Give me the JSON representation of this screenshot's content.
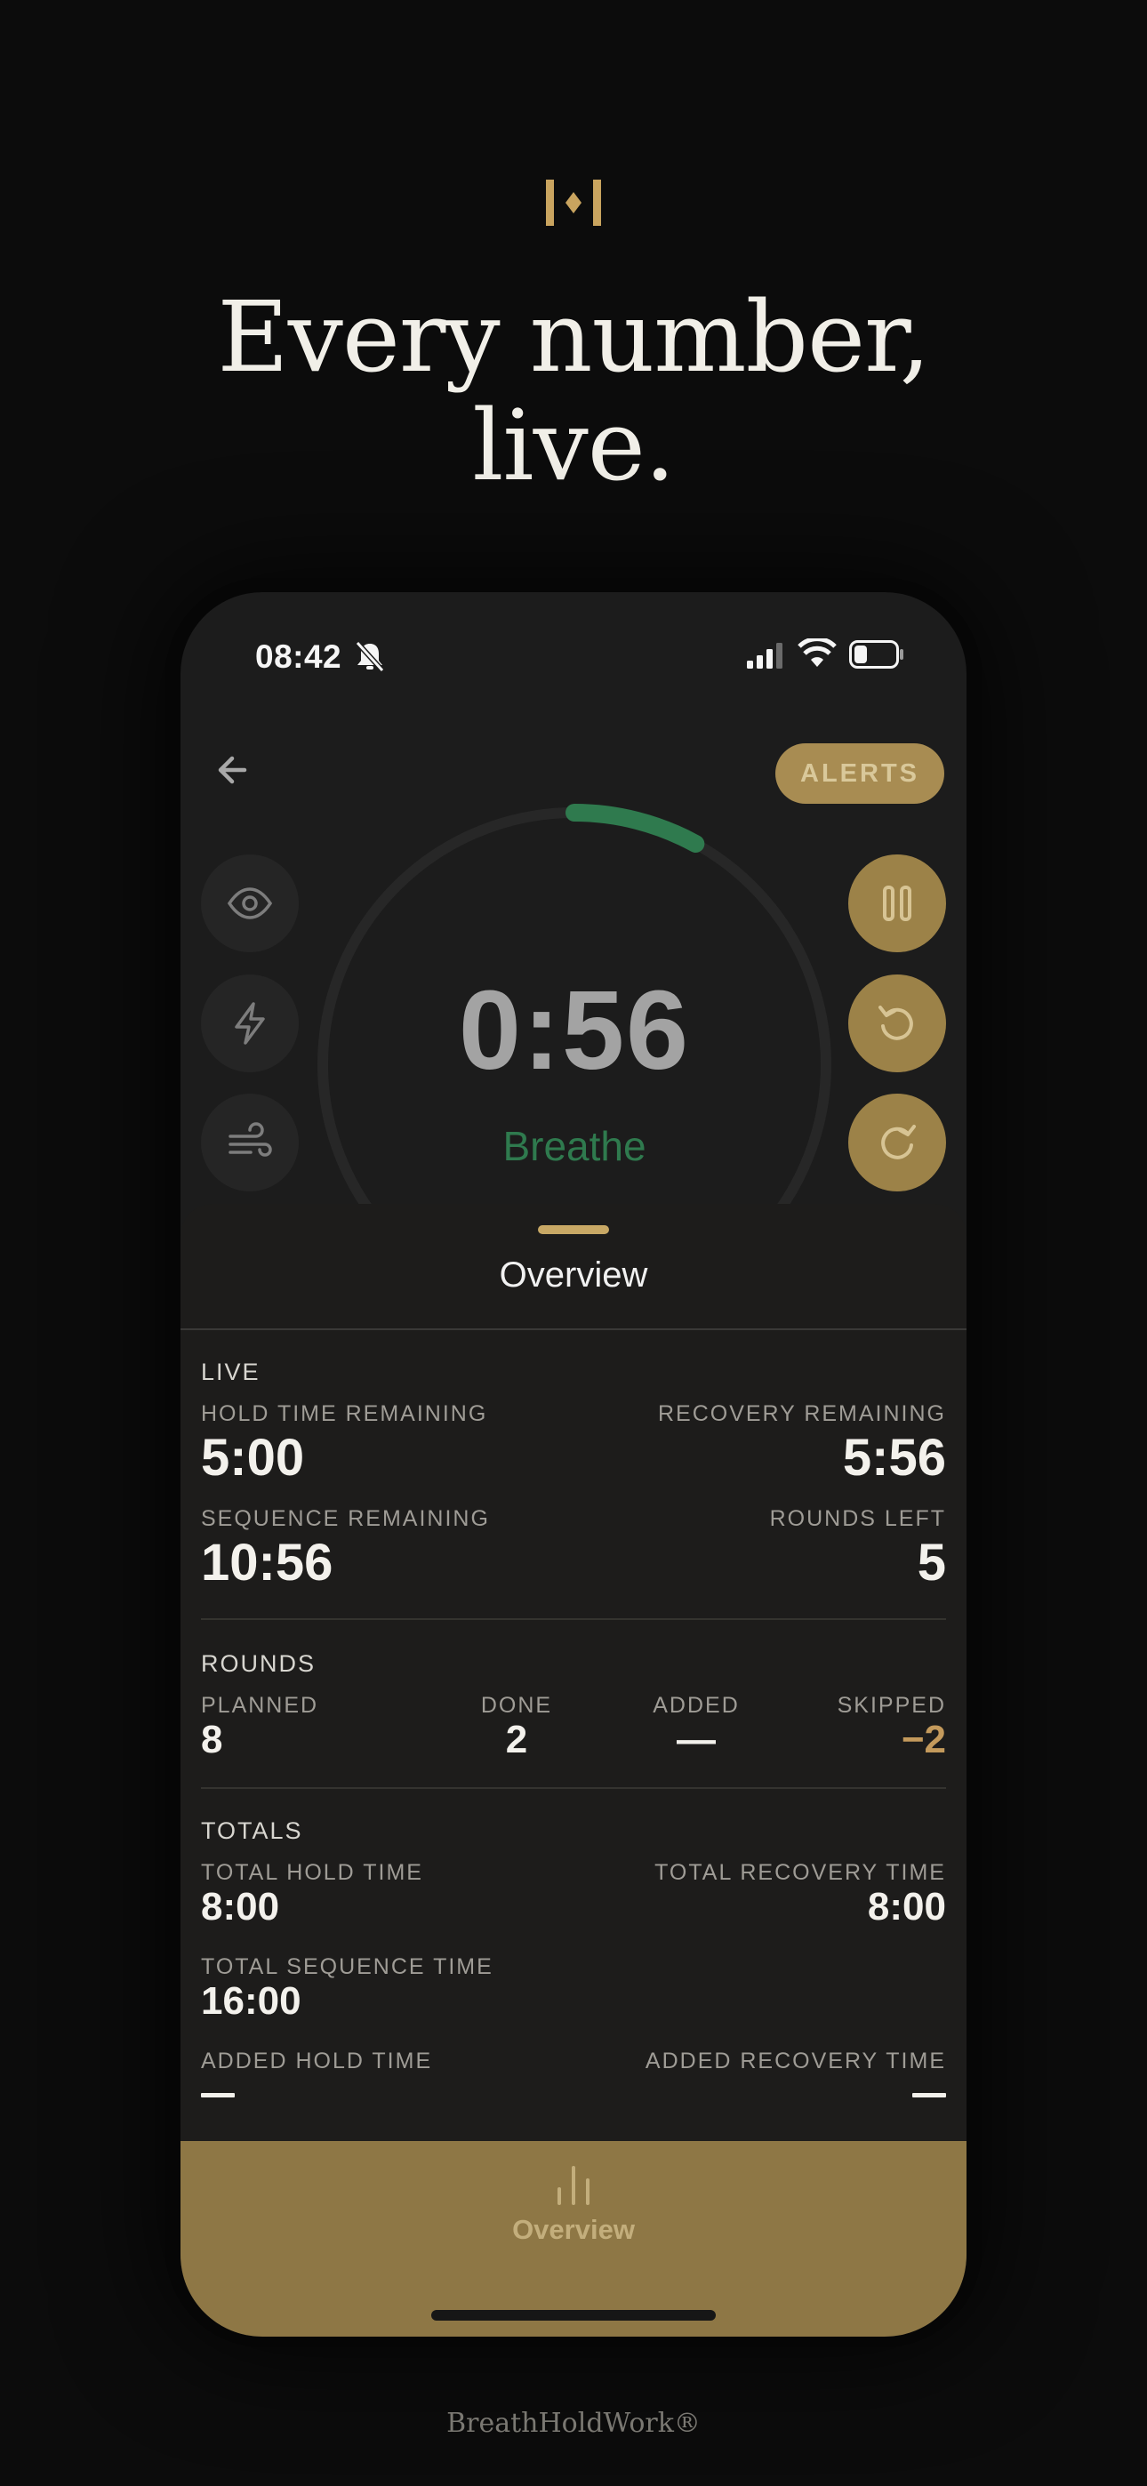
{
  "headline": {
    "line1": "Every number,",
    "line2": "live."
  },
  "status_bar": {
    "time": "08:42"
  },
  "header": {
    "alerts_label": "ALERTS"
  },
  "timer": {
    "value": "0:56",
    "phase": "Breathe",
    "ring_progress": 0.08,
    "ring_start": 0.0
  },
  "colors": {
    "accent_gold": "#a88c52",
    "breathe_green": "#2f7a4e",
    "skipped": "#c49a5c"
  },
  "sheet": {
    "title": "Overview"
  },
  "live": {
    "section": "LIVE",
    "hold_label": "HOLD TIME REMAINING",
    "hold_value": "5:00",
    "recovery_label": "RECOVERY REMAINING",
    "recovery_value": "5:56",
    "sequence_label": "SEQUENCE REMAINING",
    "sequence_value": "10:56",
    "rounds_left_label": "ROUNDS LEFT",
    "rounds_left_value": "5"
  },
  "rounds": {
    "section": "ROUNDS",
    "planned_label": "PLANNED",
    "planned_value": "8",
    "done_label": "DONE",
    "done_value": "2",
    "added_label": "ADDED",
    "added_value": "—",
    "skipped_label": "SKIPPED",
    "skipped_value": "−2"
  },
  "totals": {
    "section": "TOTALS",
    "hold_label": "TOTAL HOLD TIME",
    "hold_value": "8:00",
    "recovery_label": "TOTAL RECOVERY TIME",
    "recovery_value": "8:00",
    "sequence_label": "TOTAL SEQUENCE TIME",
    "sequence_value": "16:00",
    "added_hold_label": "ADDED HOLD TIME",
    "added_recovery_label": "ADDED RECOVERY TIME"
  },
  "tabbar": {
    "overview_label": "Overview"
  },
  "footer": {
    "brand": "BreathHoldWork®"
  },
  "icons": {
    "logo": "brand-logo-icon",
    "bell": "bell-slash-icon",
    "back": "arrow-left-icon",
    "eye": "eye-icon",
    "bolt": "bolt-icon",
    "wind": "wind-icon",
    "pause": "pause-icon",
    "restart": "restart-icon",
    "redo": "redo-icon",
    "chart": "bar-chart-icon"
  }
}
